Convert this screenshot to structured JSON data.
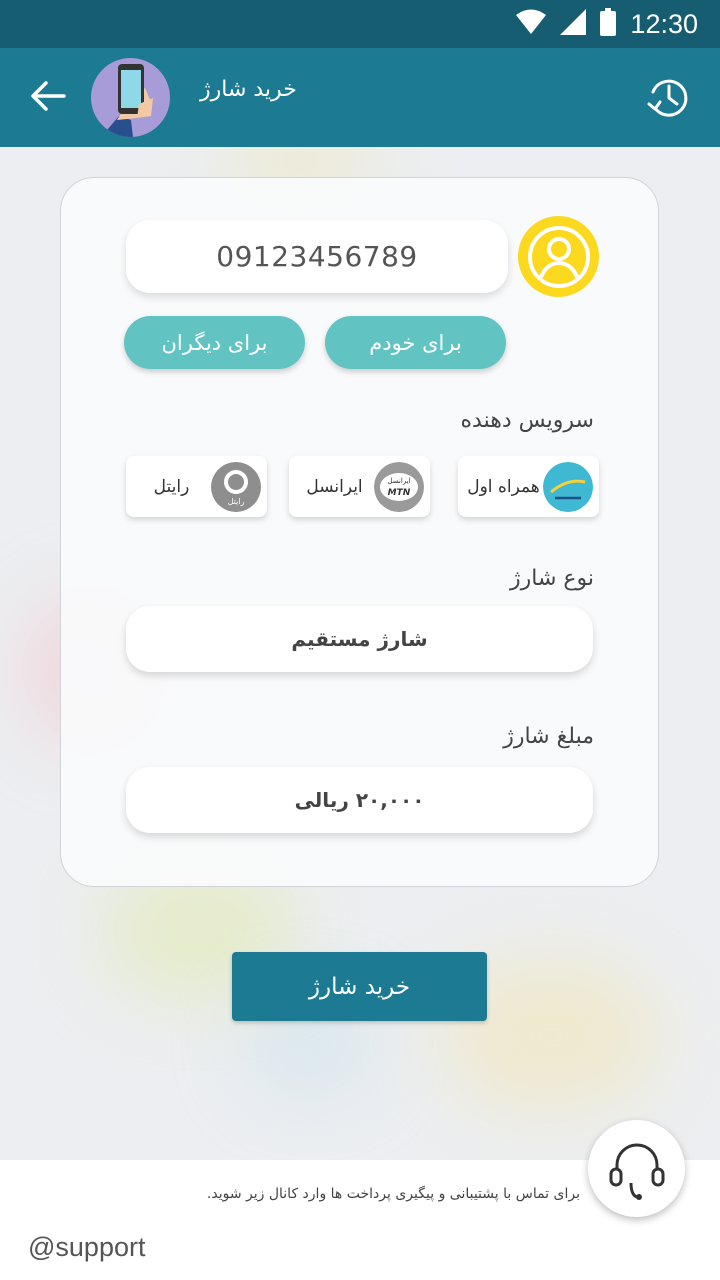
{
  "status_bar": {
    "time": "12:30"
  },
  "app_bar": {
    "title": "خرید شارژ"
  },
  "phone": {
    "value": "09123456789"
  },
  "recipient": {
    "self_label": "برای خودم",
    "others_label": "برای دیگران"
  },
  "operators": {
    "section_label": "سرویس دهنده",
    "items": [
      {
        "label": "همراه اول",
        "icon": "mci-logo"
      },
      {
        "label": "ایرانسل",
        "icon": "irancell-logo",
        "logo_text_top": "ایرانسل",
        "logo_text_bottom": "MTN"
      },
      {
        "label": "رایتل",
        "icon": "rightel-logo",
        "logo_text": "رایتل"
      }
    ]
  },
  "charge_type": {
    "label": "نوع شارژ",
    "value": "شارژ مستقیم"
  },
  "amount": {
    "label": "مبلغ شارژ",
    "value": "۲۰,۰۰۰ ریالی"
  },
  "buy_button": {
    "label": "خرید شارژ"
  },
  "footer": {
    "text": "برای تماس با پشتیبانی و پیگیری پرداخت ها وارد کانال زیر شوید.",
    "handle": "@support"
  },
  "colors": {
    "status_bar": "#175d72",
    "app_bar": "#1c7a92",
    "pill": "#61c3c2",
    "user_icon": "#fcd81f",
    "buy_button": "#1c7a92"
  }
}
